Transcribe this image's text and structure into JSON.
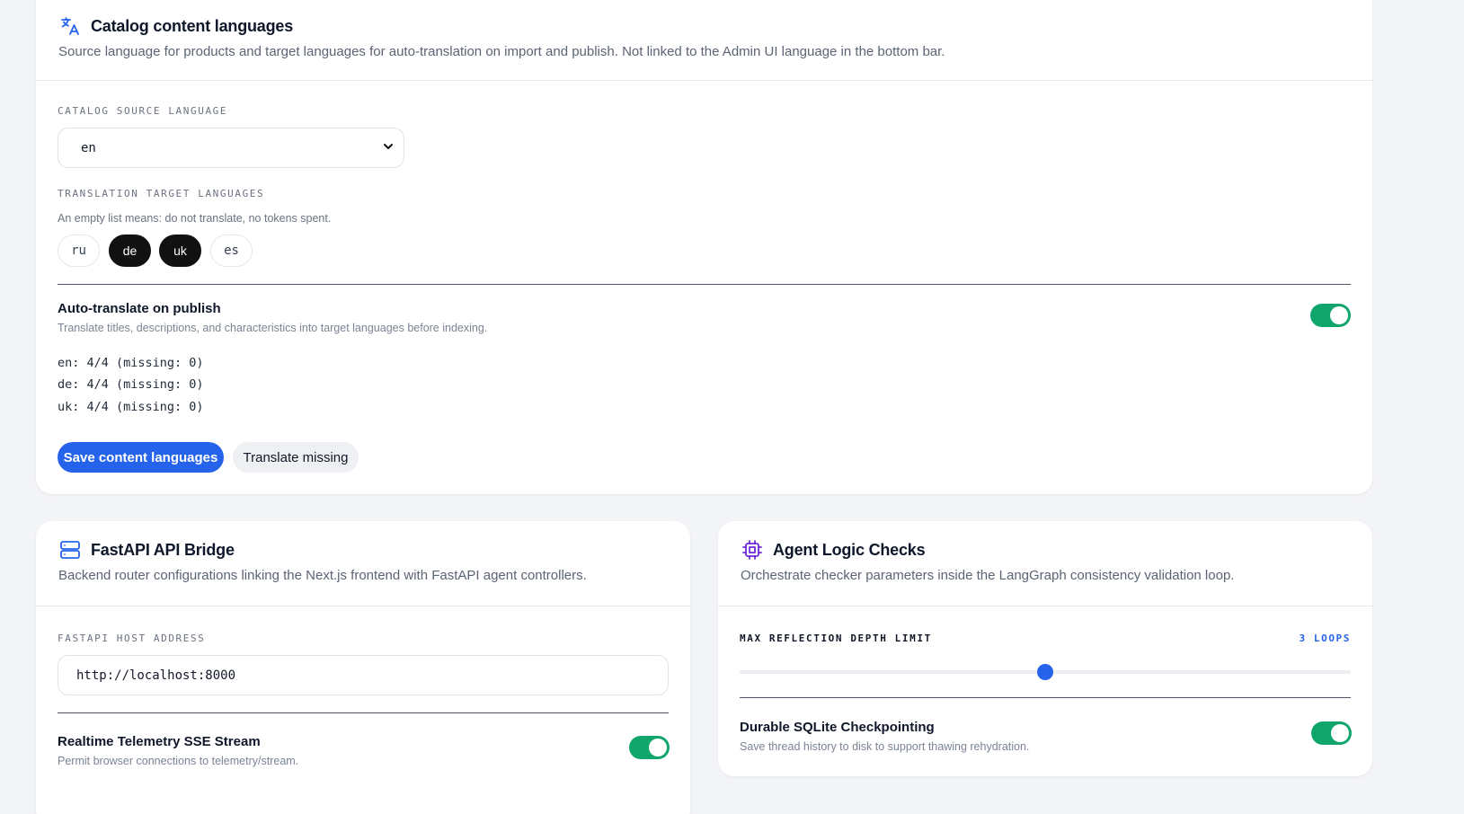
{
  "catalog": {
    "title": "Catalog content languages",
    "description": "Source language for products and target languages for auto-translation on import and publish. Not linked to the Admin UI language in the bottom bar.",
    "source_label": "CATALOG SOURCE LANGUAGE",
    "source_value": "en",
    "targets_label": "TRANSLATION TARGET LANGUAGES",
    "targets_hint": "An empty list means: do not translate, no tokens spent.",
    "chips": [
      {
        "label": "ru",
        "selected": false
      },
      {
        "label": "de",
        "selected": true
      },
      {
        "label": "uk",
        "selected": true
      },
      {
        "label": "es",
        "selected": false
      }
    ],
    "auto_translate_title": "Auto-translate on publish",
    "auto_translate_desc": "Translate titles, descriptions, and characteristics into target languages before indexing.",
    "auto_translate_on": true,
    "stats": [
      "en: 4/4 (missing: 0)",
      "de: 4/4 (missing: 0)",
      "uk: 4/4 (missing: 0)"
    ],
    "save_label": "Save content languages",
    "translate_label": "Translate missing"
  },
  "bridge": {
    "title": "FastAPI API Bridge",
    "description": "Backend router configurations linking the Next.js frontend with FastAPI agent controllers.",
    "host_label": "FASTAPI HOST ADDRESS",
    "host_value": "http://localhost:8000",
    "telemetry_title": "Realtime Telemetry SSE Stream",
    "telemetry_desc": "Permit browser connections to telemetry/stream.",
    "telemetry_on": true
  },
  "agent": {
    "title": "Agent Logic Checks",
    "description": "Orchestrate checker parameters inside the LangGraph consistency validation loop.",
    "depth_label": "MAX REFLECTION DEPTH LIMIT",
    "depth_value_label": "3 LOOPS",
    "depth_fraction": 0.5,
    "checkpoint_title": "Durable SQLite Checkpointing",
    "checkpoint_desc": "Save thread history to disk to support thawing rehydration.",
    "checkpoint_on": true
  },
  "colors": {
    "accent": "#2563eb",
    "toggle_on": "#10a56d",
    "chip_selected": "#111111",
    "icon_purple": "#6d28d9"
  },
  "icons": {
    "catalog": "translate-icon",
    "bridge": "server-icon",
    "agent": "cpu-chip-icon",
    "select": "chevron-down-icon"
  }
}
